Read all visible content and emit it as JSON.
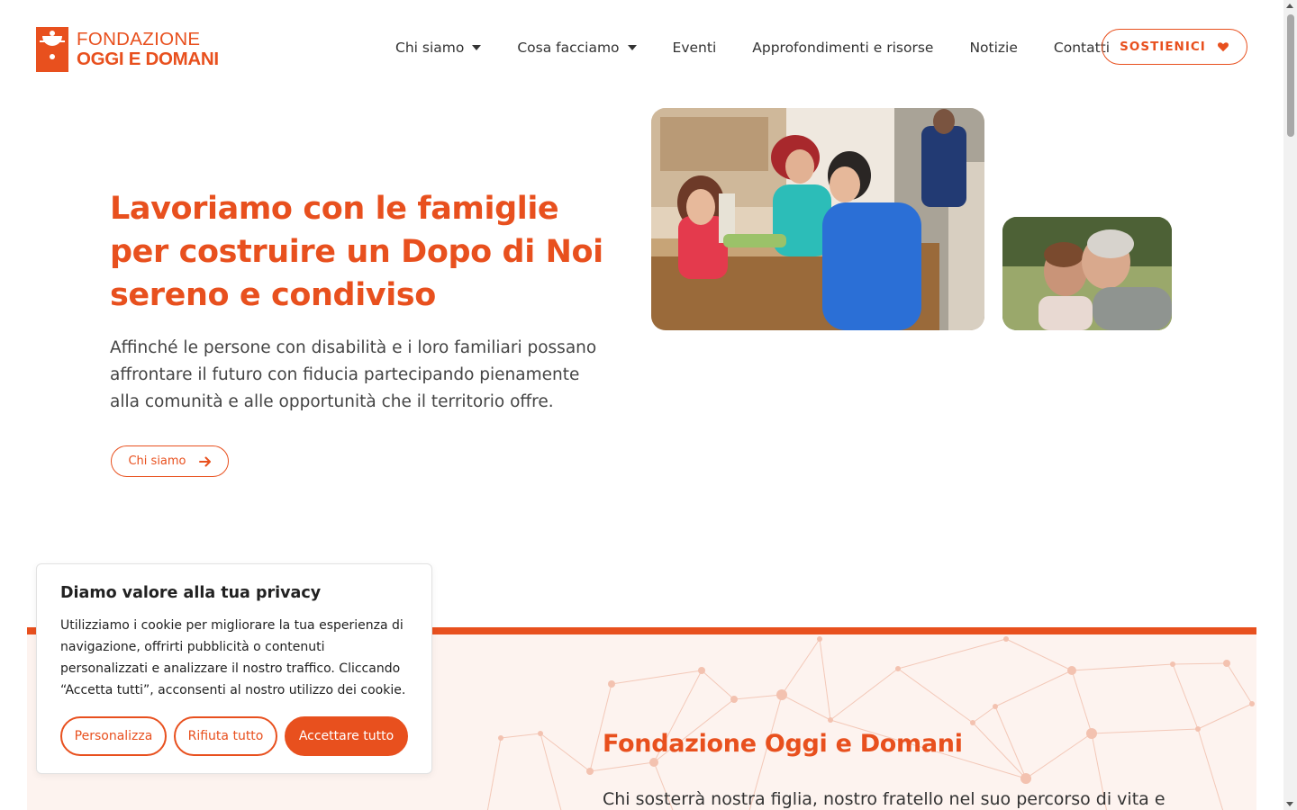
{
  "brand": {
    "line1": "FONDAZIONE",
    "line2": "OGGI E DOMANI",
    "accent_color": "#e8501e"
  },
  "nav": {
    "items": [
      {
        "label": "Chi siamo",
        "has_dropdown": true
      },
      {
        "label": "Cosa facciamo",
        "has_dropdown": true
      },
      {
        "label": "Eventi",
        "has_dropdown": false
      },
      {
        "label": "Approfondimenti e risorse",
        "has_dropdown": false
      },
      {
        "label": "Notizie",
        "has_dropdown": false
      },
      {
        "label": "Contatti",
        "has_dropdown": false
      }
    ],
    "cta_label": "SOSTIENICI",
    "cta_icon": "heart-icon"
  },
  "hero": {
    "title": "Lavoriamo con le famiglie per costruire un Dopo di Noi sereno e condiviso",
    "text": "Affinché le persone con disabilità e i loro familiari possano affrontare il futuro con fiducia partecipando pienamente alla comunità e alle opportunità che il territorio offre.",
    "button_label": "Chi siamo",
    "button_icon": "arrow-right-icon"
  },
  "section": {
    "title": "Fondazione Oggi e Domani",
    "text": "Chi sosterrà nostra figlia, nostro fratello nel suo percorso di vita e"
  },
  "cookie": {
    "title": "Diamo valore alla tua privacy",
    "text": "Utilizziamo i cookie per migliorare la tua esperienza di navigazione, offrirti pubblicità o contenuti personalizzati e analizzare il nostro traffico. Cliccando “Accetta tutti”, acconsenti al nostro utilizzo dei cookie.",
    "buttons": {
      "customize": "Personalizza",
      "reject": "Rifiuta tutto",
      "accept": "Accettare tutto"
    }
  }
}
